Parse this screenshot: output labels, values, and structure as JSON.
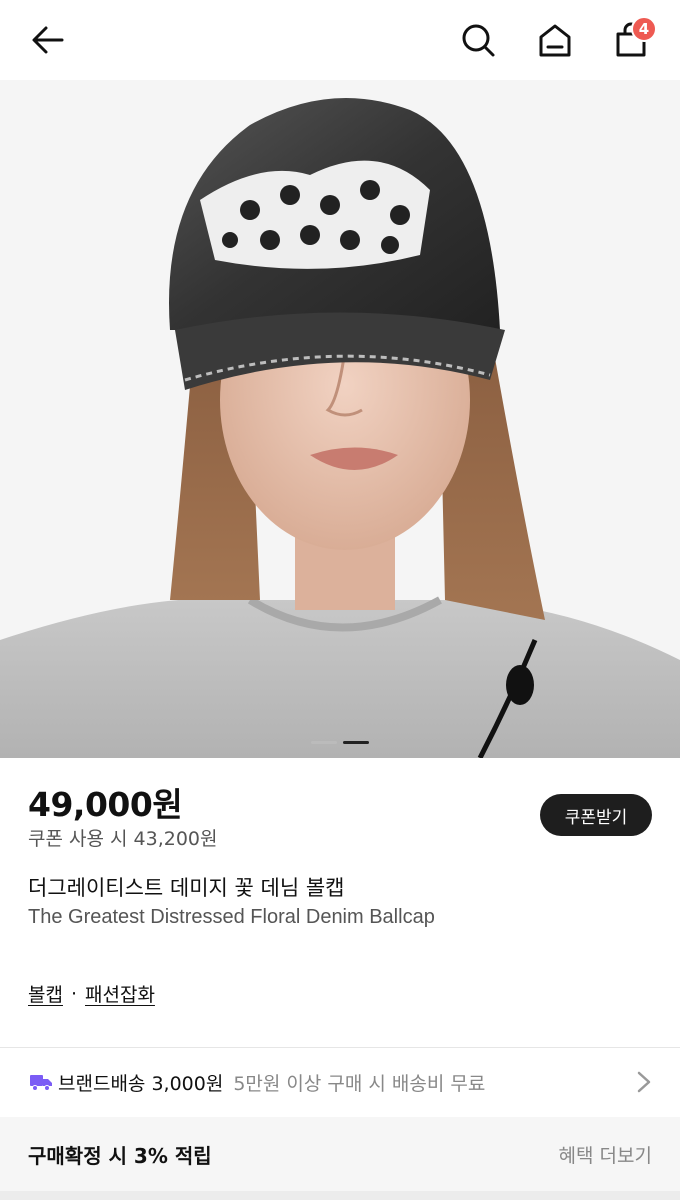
{
  "header": {
    "icons": [
      "back-arrow-icon",
      "search-icon",
      "home-icon",
      "shopping-bag-icon"
    ],
    "cart_count": "4",
    "badge_color": "#ee5a52"
  },
  "gallery": {
    "current_index": 2,
    "total": 2
  },
  "product": {
    "price": "49,000원",
    "coupon_price": "쿠폰 사용 시 43,200원",
    "coupon_button": "쿠폰받기",
    "name_ko": "더그레이티스트 데미지 꽃 데님 볼캡",
    "name_en": "The Greatest Distressed Floral Denim Ballcap",
    "categories": [
      "볼캡",
      "패션잡화"
    ],
    "category_separator": "·"
  },
  "shipping": {
    "icon": "truck-icon",
    "icon_color": "#7b5cf5",
    "brand_fee": "브랜드배송 3,000원",
    "free_note": "5만원 이상 구매 시 배송비 무료"
  },
  "benefit": {
    "title": "구매확정 시 3% 적립",
    "more": "혜택 더보기"
  }
}
